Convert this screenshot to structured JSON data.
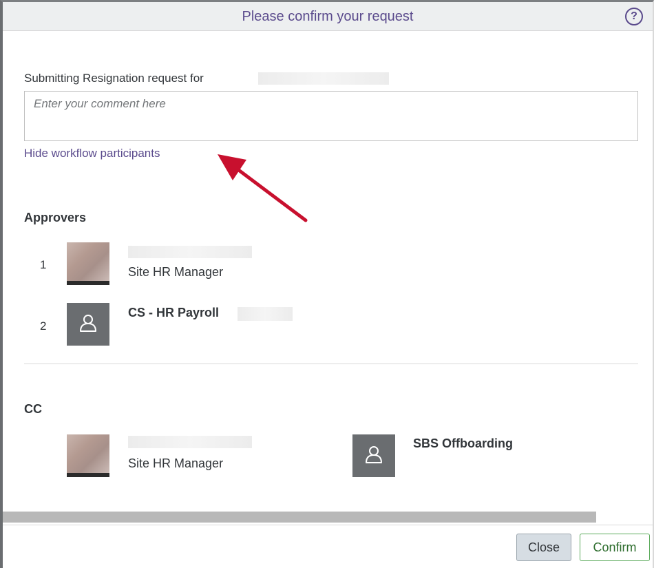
{
  "dialog": {
    "title": "Please confirm your request",
    "help_icon": "question-circle-icon"
  },
  "request": {
    "label": "Submitting Resignation request for",
    "comment_placeholder": "Enter your comment here"
  },
  "workflow_link": "Hide workflow participants",
  "approvers": {
    "title": "Approvers",
    "items": [
      {
        "order": "1",
        "name": "",
        "role": "Site HR Manager",
        "avatar": "photo"
      },
      {
        "order": "2",
        "name": "CS - HR Payroll",
        "role": "",
        "avatar": "person-icon"
      }
    ]
  },
  "cc": {
    "title": "CC",
    "items": [
      {
        "name": "",
        "role": "Site HR Manager",
        "avatar": "photo"
      },
      {
        "name": "SBS Offboarding",
        "role": "",
        "avatar": "person-icon"
      }
    ]
  },
  "footer": {
    "close_label": "Close",
    "confirm_label": "Confirm"
  },
  "colors": {
    "accent": "#5a4a8c",
    "annotation_arrow": "#c8102e",
    "confirm_border": "#5aaa5a"
  }
}
